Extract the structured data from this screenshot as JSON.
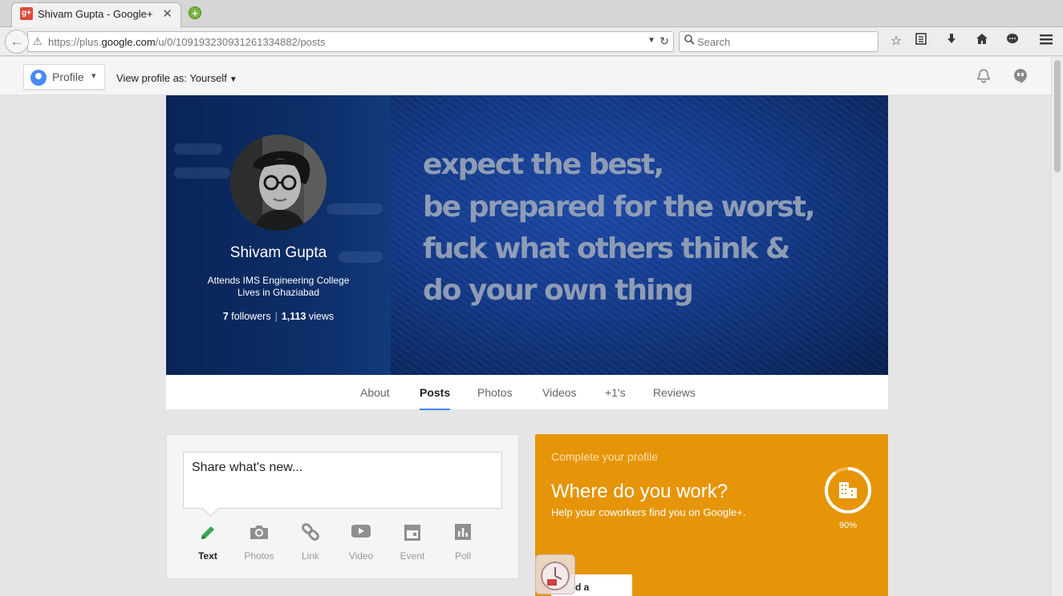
{
  "browser": {
    "tab_title": "Shivam Gupta - Google+",
    "tab_favicon": "g+",
    "url_prefix": "https://plus.",
    "url_domain": "google.com",
    "url_path": "/u/0/109193230931261334882/posts",
    "search_placeholder": "Search"
  },
  "header": {
    "profile_label": "Profile",
    "view_as_label": "View profile as:",
    "view_as_value": "Yourself"
  },
  "cover": {
    "name": "Shivam Gupta",
    "line1": "Attends IMS Engineering College",
    "line2": "Lives in Ghaziabad",
    "followers_count": "7",
    "followers_label": "followers",
    "views_count": "1,113",
    "views_label": "views",
    "quote": [
      "expect the best,",
      "be prepared for the worst,",
      "fuck what others think &",
      "do your own thing"
    ]
  },
  "tabs": [
    {
      "label": "About"
    },
    {
      "label": "Posts"
    },
    {
      "label": "Photos"
    },
    {
      "label": "Videos"
    },
    {
      "label": "+1's"
    },
    {
      "label": "Reviews"
    }
  ],
  "share": {
    "placeholder": "Share what's new...",
    "actions": [
      {
        "label": "Text",
        "icon": "pencil-icon"
      },
      {
        "label": "Photos",
        "icon": "camera-icon"
      },
      {
        "label": "Link",
        "icon": "link-icon"
      },
      {
        "label": "Video",
        "icon": "video-icon"
      },
      {
        "label": "Event",
        "icon": "calendar-icon"
      },
      {
        "label": "Poll",
        "icon": "poll-icon"
      }
    ]
  },
  "profile_card": {
    "eyebrow": "Complete your profile",
    "title": "Where do you work?",
    "subtitle": "Help your coworkers find you on Google+.",
    "percent": 0.9,
    "percent_label": "90%",
    "button_label": "d a company",
    "accent_color": "#e59507"
  },
  "colors": {
    "active_tab_underline": "#4285f4",
    "text_action_green": "#34a853"
  }
}
